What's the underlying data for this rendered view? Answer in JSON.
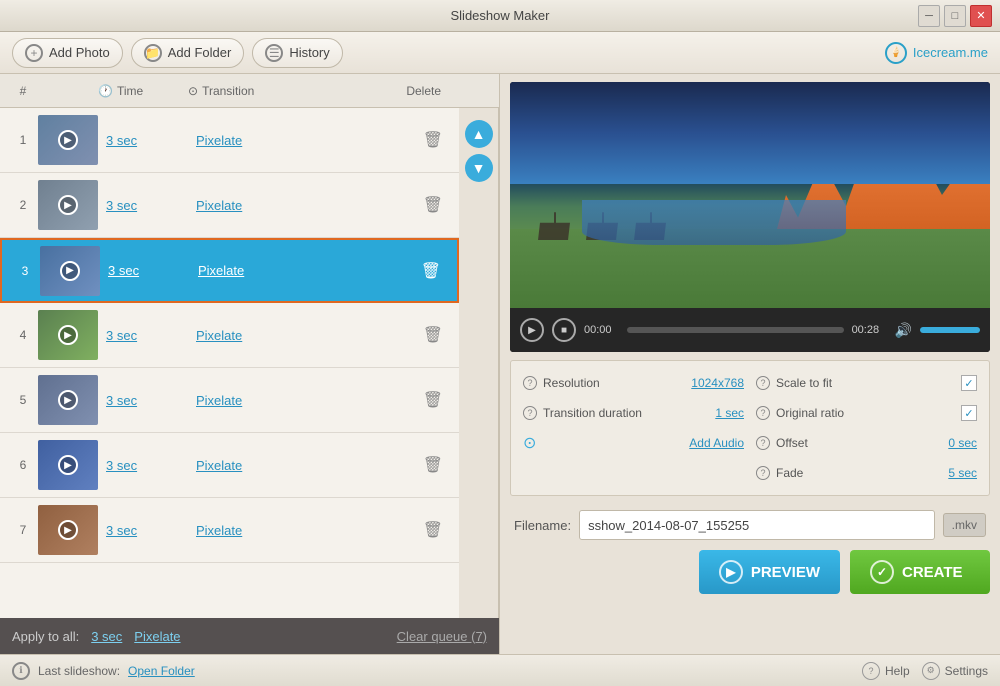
{
  "app": {
    "title": "Slideshow Maker"
  },
  "titlebar": {
    "min_label": "─",
    "max_label": "□",
    "close_label": "✕"
  },
  "toolbar": {
    "add_photo_label": "Add Photo",
    "add_folder_label": "Add Folder",
    "history_label": "History",
    "brand_label": "Icecream.me"
  },
  "table": {
    "col_num": "#",
    "col_time": "Time",
    "col_transition": "Transition",
    "col_delete": "Delete"
  },
  "slides": [
    {
      "num": "1",
      "time": "3 sec",
      "transition": "Pixelate",
      "thumb_class": "thumb-1",
      "active": false
    },
    {
      "num": "2",
      "time": "3 sec",
      "transition": "Pixelate",
      "thumb_class": "thumb-2",
      "active": false
    },
    {
      "num": "3",
      "time": "3 sec",
      "transition": "Pixelate",
      "thumb_class": "thumb-3",
      "active": true
    },
    {
      "num": "4",
      "time": "3 sec",
      "transition": "Pixelate",
      "thumb_class": "thumb-4",
      "active": false
    },
    {
      "num": "5",
      "time": "3 sec",
      "transition": "Pixelate",
      "thumb_class": "thumb-5",
      "active": false
    },
    {
      "num": "6",
      "time": "3 sec",
      "transition": "Pixelate",
      "thumb_class": "thumb-6",
      "active": false
    },
    {
      "num": "7",
      "time": "3 sec",
      "transition": "Pixelate",
      "thumb_class": "thumb-7",
      "active": false
    }
  ],
  "apply_bar": {
    "label": "Apply to all:",
    "time": "3 sec",
    "transition": "Pixelate",
    "clear_label": "Clear queue (7)"
  },
  "video": {
    "time_start": "00:00",
    "time_end": "00:28",
    "progress_percent": 0
  },
  "settings": {
    "resolution_label": "Resolution",
    "resolution_value": "1024x768",
    "transition_duration_label": "Transition duration",
    "transition_duration_value": "1 sec",
    "add_audio_label": "Add Audio",
    "scale_to_fit_label": "Scale to fit",
    "scale_to_fit_checked": true,
    "original_ratio_label": "Original ratio",
    "original_ratio_checked": true,
    "offset_label": "Offset",
    "offset_value": "0 sec",
    "fade_label": "Fade",
    "fade_value": "5 sec"
  },
  "filename": {
    "label": "Filename:",
    "value": "sshow_2014-08-07_155255",
    "extension": ".mkv"
  },
  "buttons": {
    "preview_label": "PREVIEW",
    "create_label": "CREATE"
  },
  "status": {
    "last_slideshow_label": "Last slideshow:",
    "open_folder_label": "Open Folder",
    "help_label": "Help",
    "settings_label": "Settings"
  }
}
